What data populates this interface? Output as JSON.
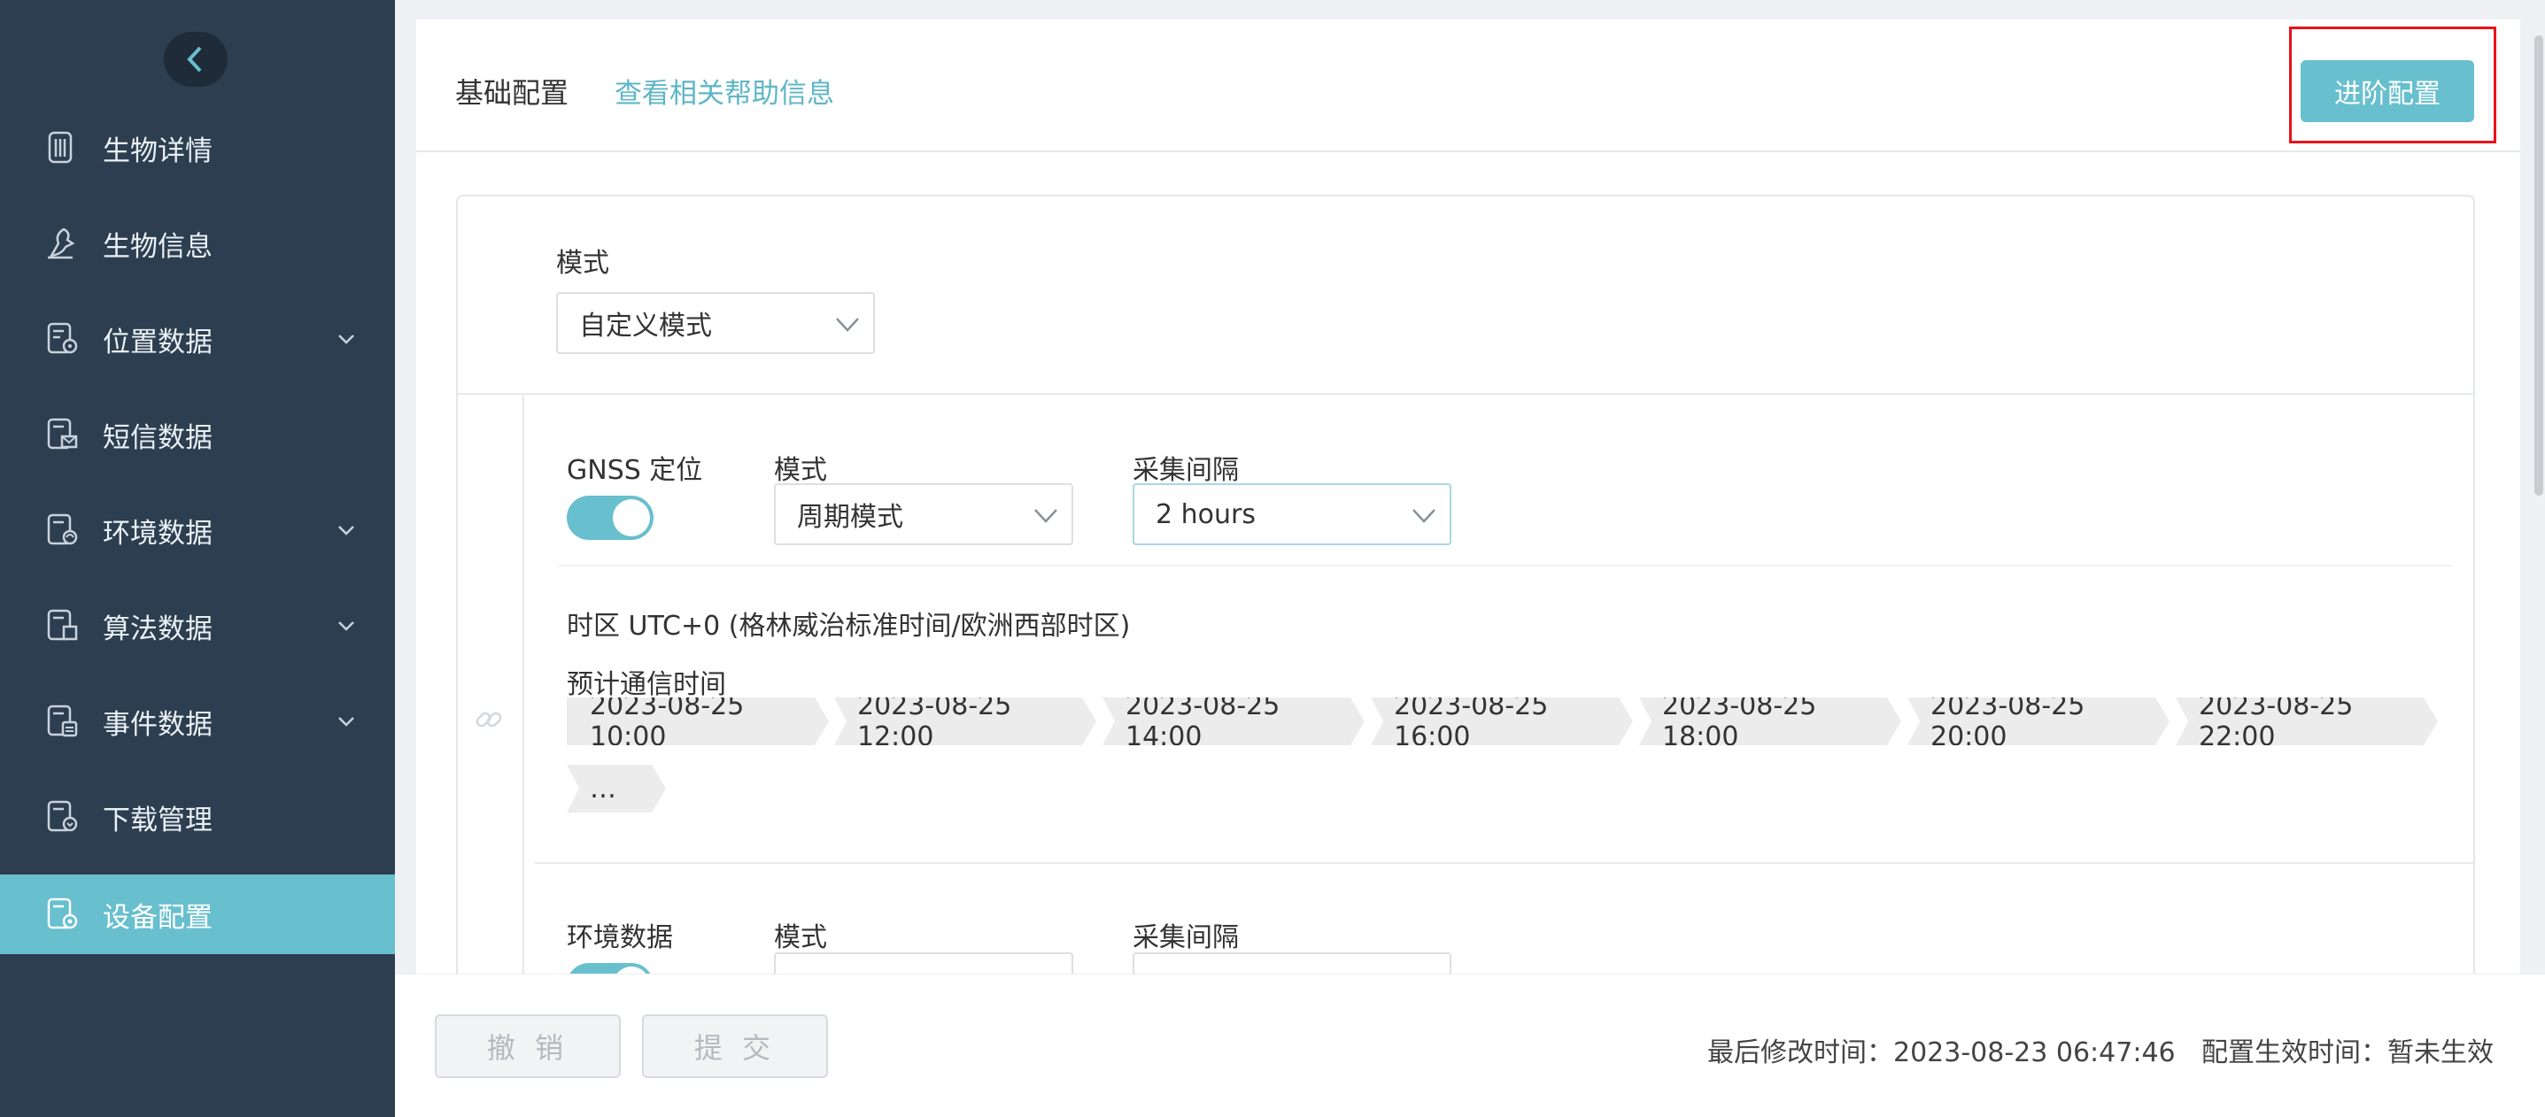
{
  "sidebar": {
    "items": [
      {
        "label": "生物详情",
        "icon": "document-stack-icon",
        "expandable": false
      },
      {
        "label": "生物信息",
        "icon": "bird-icon",
        "expandable": false
      },
      {
        "label": "位置数据",
        "icon": "location-document-icon",
        "expandable": true
      },
      {
        "label": "短信数据",
        "icon": "message-document-icon",
        "expandable": false
      },
      {
        "label": "环境数据",
        "icon": "environment-document-icon",
        "expandable": true
      },
      {
        "label": "算法数据",
        "icon": "algorithm-document-icon",
        "expandable": true
      },
      {
        "label": "事件数据",
        "icon": "event-document-icon",
        "expandable": true
      },
      {
        "label": "下载管理",
        "icon": "download-document-icon",
        "expandable": false
      },
      {
        "label": "设备配置",
        "icon": "device-config-icon",
        "expandable": false,
        "active": true
      }
    ],
    "accent_color": "#68bfce",
    "background_color": "#2d3e50"
  },
  "header": {
    "title": "基础配置",
    "help_link": "查看相关帮助信息",
    "advanced_button": "进阶配置"
  },
  "config": {
    "mode_label": "模式",
    "mode_value": "自定义模式",
    "gnss": {
      "label": "GNSS 定位",
      "enabled": true,
      "mode_label": "模式",
      "mode_value": "周期模式",
      "interval_label": "采集间隔",
      "interval_value": "2 hours"
    },
    "timezone": "时区 UTC+0 (格林威治标准时间/欧洲西部时区)",
    "forecast_label": "预计通信时间",
    "forecast_times": [
      "2023-08-25 10:00",
      "2023-08-25 12:00",
      "2023-08-25 14:00",
      "2023-08-25 16:00",
      "2023-08-25 18:00",
      "2023-08-25 20:00",
      "2023-08-25 22:00",
      "…"
    ],
    "env": {
      "label": "环境数据",
      "enabled": true,
      "mode_label": "模式",
      "interval_label": "采集间隔"
    }
  },
  "footer": {
    "cancel": "撤 销",
    "submit": "提 交",
    "last_modified": "最后修改时间：2023-08-23 06:47:46",
    "effective": "配置生效时间：暂未生效"
  }
}
